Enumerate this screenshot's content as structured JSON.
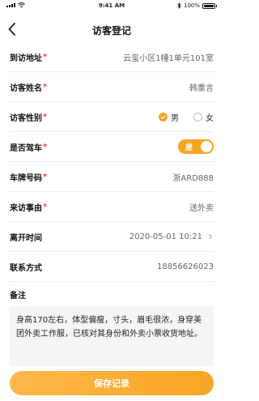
{
  "status_bar": {
    "time": "9:41 AM",
    "battery": "100%"
  },
  "nav": {
    "title": "访客登记"
  },
  "form": {
    "address": {
      "label": "到访地址",
      "value": "云玺小区1幢1单元101室"
    },
    "name": {
      "label": "访客姓名",
      "value": "韩重言"
    },
    "gender": {
      "label": "访客性别",
      "options": [
        "男",
        "女"
      ],
      "selected": "男"
    },
    "driving": {
      "label": "是否驾车",
      "toggle_text": "是",
      "on": true
    },
    "plate": {
      "label": "车牌号码",
      "value": "浙ARD888"
    },
    "reason": {
      "label": "来访事由",
      "value": "送外卖"
    },
    "leave_time": {
      "label": "离开时间",
      "value": "2020-05-01 10:21"
    },
    "contact": {
      "label": "联系方式",
      "value": "18856626023"
    },
    "remark": {
      "label": "备注",
      "value": "身高170左右，体型偏瘦，寸头，眉毛很浓，身穿美团外卖工作服，已核对其身份和外卖小票收货地址。"
    }
  },
  "save_button": {
    "label": "保存记录"
  },
  "colors": {
    "accent": "#f5a623",
    "required": "#e94a3b"
  }
}
